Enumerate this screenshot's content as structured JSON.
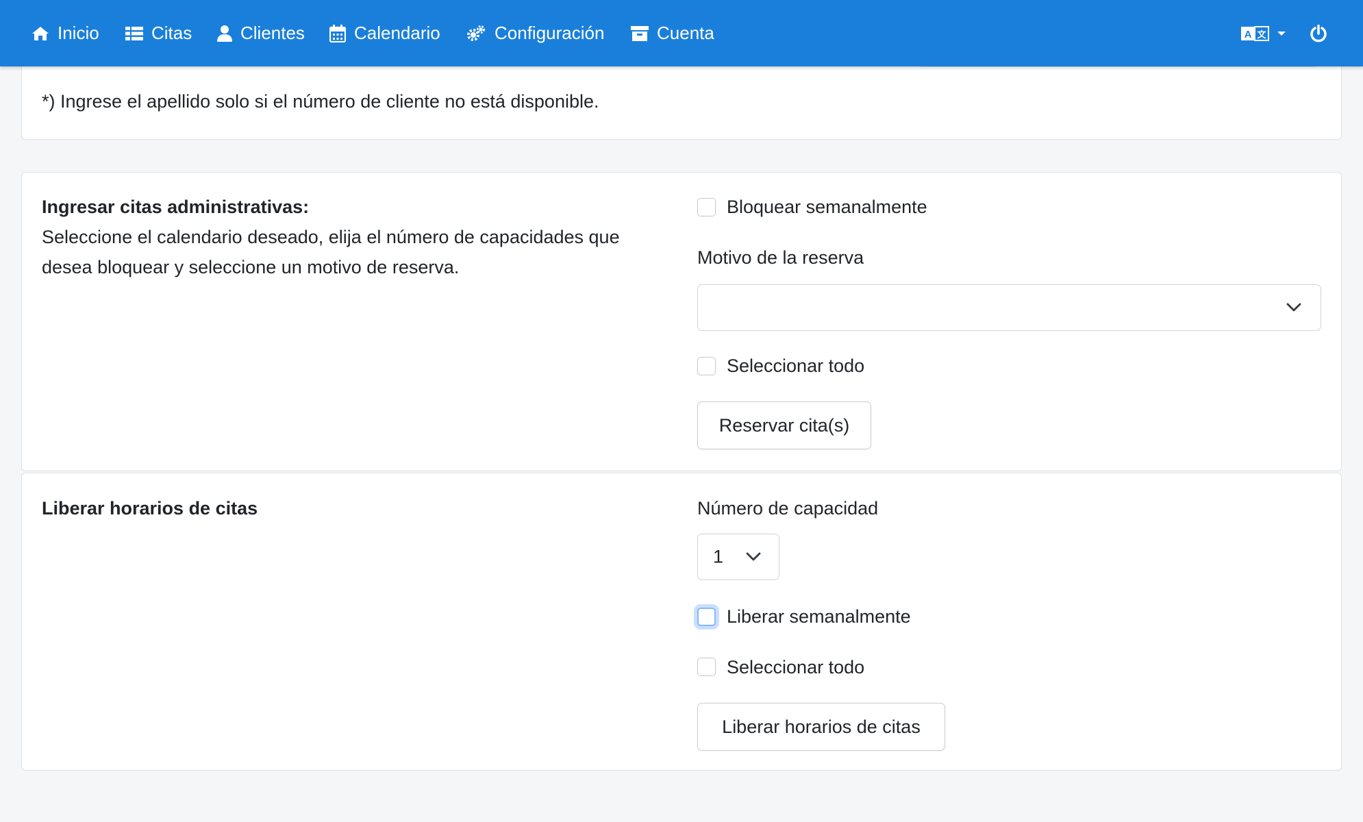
{
  "nav": {
    "items": [
      {
        "label": "Inicio",
        "icon": "home-icon"
      },
      {
        "label": "Citas",
        "icon": "list-icon"
      },
      {
        "label": "Clientes",
        "icon": "user-icon"
      },
      {
        "label": "Calendario",
        "icon": "calendar-icon"
      },
      {
        "label": "Configuración",
        "icon": "gears-icon"
      },
      {
        "label": "Cuenta",
        "icon": "archive-icon"
      }
    ],
    "language_icon": "language-icon",
    "logout_icon": "power-icon",
    "bar_color": "#1a7fdb"
  },
  "search_card": {
    "note": "*) Ingrese el apellido solo si el número de cliente no está disponible."
  },
  "admin_card": {
    "title": "Ingresar citas administrativas:",
    "description_line1": "Seleccione el calendario deseado, elija el número de capacidades que",
    "description_line2": "desea bloquear y seleccione un motivo de reserva.",
    "weekly_block_label": "Bloquear semanalmente",
    "reason_label": "Motivo de la reserva",
    "reason_value": "",
    "select_all_label": "Seleccionar todo",
    "reserve_button": "Reservar cita(s)"
  },
  "release_card": {
    "title": "Liberar horarios de citas",
    "capacity_label": "Número de capacidad",
    "capacity_value": "1",
    "weekly_release_label": "Liberar semanalmente",
    "select_all_label": "Seleccionar todo",
    "release_button": "Liberar horarios de citas"
  }
}
